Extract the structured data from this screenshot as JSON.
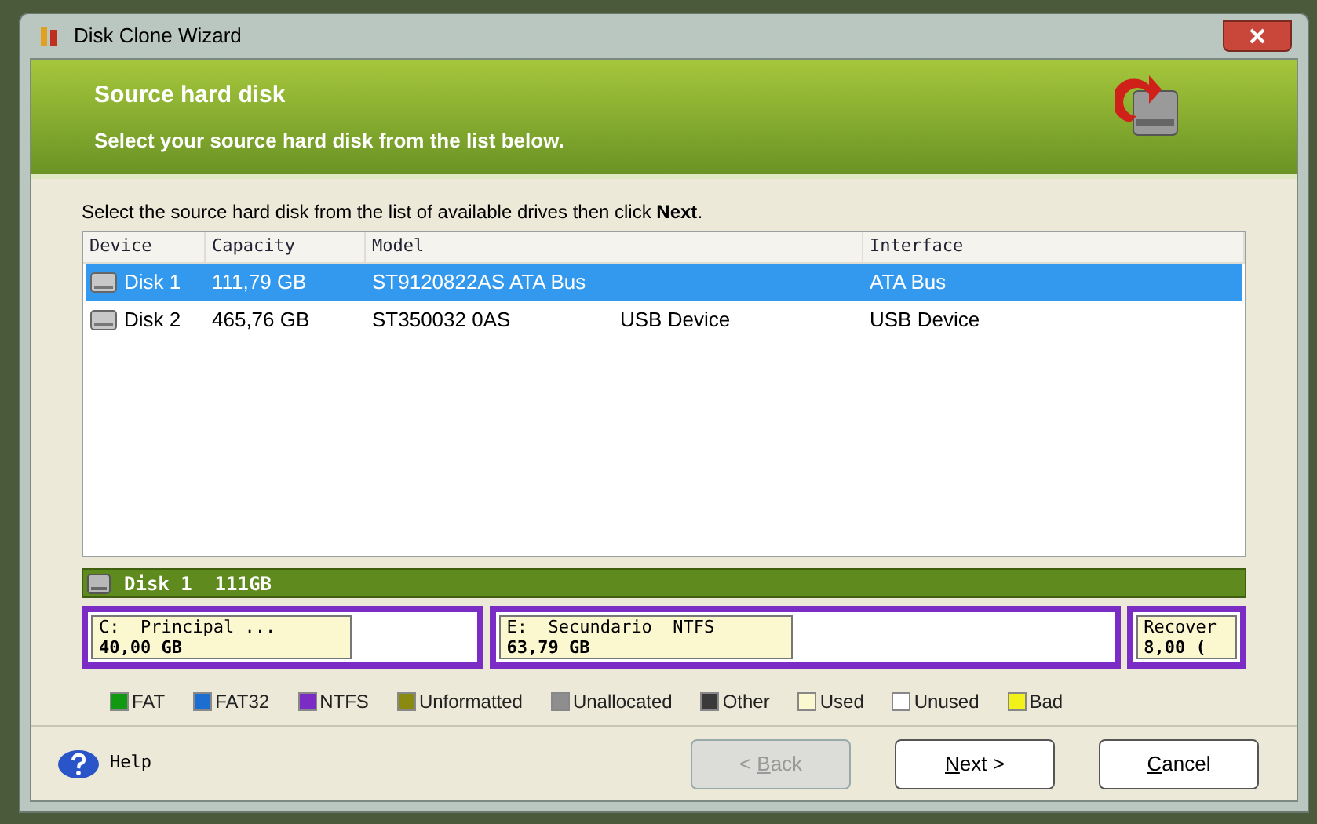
{
  "window": {
    "title": "Disk Clone Wizard"
  },
  "header": {
    "title": "Source hard disk",
    "subtitle": "Select your source hard disk from the list below."
  },
  "instruction": "Select the source hard disk from the list of available drives then click **Next**.",
  "table": {
    "columns": [
      "Device",
      "Capacity",
      "Model",
      "Interface"
    ],
    "rows": [
      {
        "device": "Disk 1",
        "capacity": "111,79 GB",
        "model": "ST9120822AS ATA Bus",
        "interface": "ATA Bus",
        "selected": true
      },
      {
        "device": "Disk 2",
        "capacity": "465,76 GB",
        "model": "ST350032 0AS",
        "model_extra": "USB Device",
        "interface": "USB Device",
        "selected": false
      }
    ]
  },
  "disk_bar": {
    "label": "Disk 1  111GB"
  },
  "partitions": [
    {
      "name": "C:  Principal ...",
      "size": "40,00 GB",
      "color": "#7b2cc4",
      "level": 0.68
    },
    {
      "name": "E:  Secundario  NTFS",
      "size": "63,79 GB",
      "color": "#7b2cc4",
      "level": 0.48
    },
    {
      "name": "Recover",
      "size": "8,00 (",
      "color": "#7b2cc4",
      "level": 1
    }
  ],
  "legend": [
    {
      "label": "FAT",
      "color": "#119a11"
    },
    {
      "label": "FAT32",
      "color": "#1c6fd1"
    },
    {
      "label": "NTFS",
      "color": "#7b2cc4"
    },
    {
      "label": "Unformatted",
      "color": "#8a8a10"
    },
    {
      "label": "Unallocated",
      "color": "#8e8e8e"
    },
    {
      "label": "Other",
      "color": "#3a3a3a"
    },
    {
      "label": "Used",
      "color": "#fbf7cf"
    },
    {
      "label": "Unused",
      "color": "#ffffff"
    },
    {
      "label": "Bad",
      "color": "#f2f21a"
    }
  ],
  "help": "Help",
  "buttons": [
    {
      "before": "< ",
      "key": "B",
      "after": "ack",
      "disabled": true
    },
    {
      "key": "N",
      "after": "ext >",
      "disabled": false
    },
    {
      "key": "C",
      "after": "ancel",
      "disabled": false
    }
  ]
}
